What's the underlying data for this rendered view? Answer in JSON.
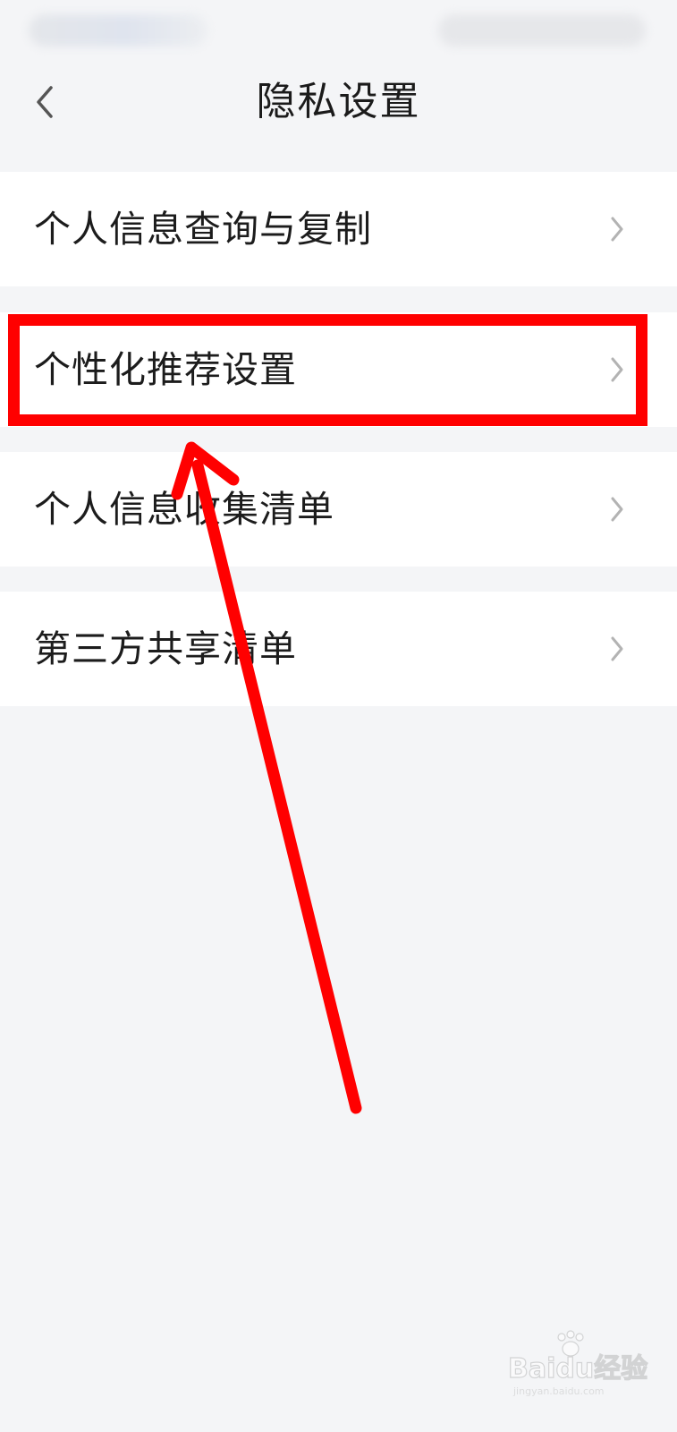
{
  "header": {
    "title": "隐私设置",
    "back_icon": "chevron-left-icon"
  },
  "menu": {
    "items": [
      {
        "label": "个人信息查询与复制",
        "icon": "chevron-right-icon"
      },
      {
        "label": "个性化推荐设置",
        "icon": "chevron-right-icon",
        "highlighted": true
      },
      {
        "label": "个人信息收集清单",
        "icon": "chevron-right-icon"
      },
      {
        "label": "第三方共享清单",
        "icon": "chevron-right-icon"
      }
    ]
  },
  "annotation": {
    "color": "#ff0000",
    "target": "个性化推荐设置"
  },
  "watermark": {
    "text": "Baidu经验",
    "sub": "jingyan.baidu.com"
  },
  "colors": {
    "background": "#f4f5f7",
    "item_background": "#ffffff",
    "text": "#1c1c1c",
    "chevron": "#b3b3b3"
  }
}
